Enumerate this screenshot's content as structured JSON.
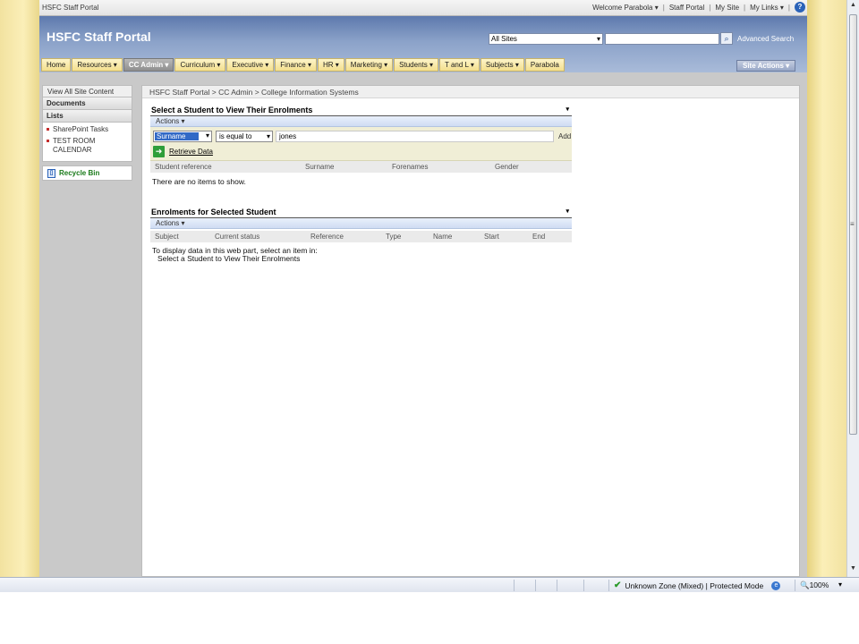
{
  "topbar": {
    "site_name": "HSFC Staff Portal",
    "welcome": "Welcome Parabola",
    "staff_portal": "Staff Portal",
    "my_site": "My Site",
    "my_links": "My Links",
    "dropdown_glyph": "▾",
    "separator": "|",
    "help_glyph": "?"
  },
  "header": {
    "title": "HSFC Staff Portal",
    "scope_value": "All Sites",
    "search_placeholder": "",
    "search_glyph": "⌕",
    "advanced_search": "Advanced Search",
    "site_actions": "Site Actions ▾"
  },
  "nav": {
    "tabs": [
      {
        "label": "Home"
      },
      {
        "label": "Resources ▾"
      },
      {
        "label": "CC Admin ▾"
      },
      {
        "label": "Curriculum ▾"
      },
      {
        "label": "Executive ▾"
      },
      {
        "label": "Finance ▾"
      },
      {
        "label": "HR ▾"
      },
      {
        "label": "Marketing ▾"
      },
      {
        "label": "Students ▾"
      },
      {
        "label": "T and L ▾"
      },
      {
        "label": "Subjects ▾"
      },
      {
        "label": "Parabola"
      }
    ]
  },
  "leftnav": {
    "view_all": "View All Site Content",
    "documents": "Documents",
    "lists": "Lists",
    "list_items": [
      {
        "label": "SharePoint Tasks"
      },
      {
        "label": "TEST ROOM CALENDAR"
      }
    ],
    "recycle_bin": "Recycle Bin",
    "bin_glyph": "▯"
  },
  "breadcrumb": "HSFC Staff Portal > CC Admin > College Information Systems",
  "webpart1": {
    "title": "Select a Student to View Their Enrolments",
    "menu_glyph": "▾",
    "actions": "Actions ▾",
    "filter_field": "Surname",
    "filter_operator": "is equal to",
    "filter_value": "jones",
    "add_label": "Add",
    "retrieve_label": "Retrieve Data",
    "go_glyph": "➜",
    "columns": [
      "Student reference",
      "Surname",
      "Forenames",
      "Gender"
    ],
    "empty_message": "There are no items to show."
  },
  "webpart2": {
    "title": "Enrolments for Selected Student",
    "menu_glyph": "▾",
    "actions": "Actions ▾",
    "columns": [
      "Subject",
      "Current status",
      "Reference",
      "Type",
      "Name",
      "Start",
      "End"
    ],
    "info_line1": "To display data in this web part, select an item in:",
    "info_line2": "Select a Student to View Their Enrolments"
  },
  "statusbar": {
    "zone": "Unknown Zone (Mixed) | Protected Mode",
    "check_glyph": "✔",
    "globe_glyph": "e",
    "zoom": "🔍100%",
    "zoom_dropdown": "▾"
  },
  "scrollbar": {
    "up_glyph": "▲",
    "down_glyph": "▼",
    "grip_glyph": "≡"
  }
}
